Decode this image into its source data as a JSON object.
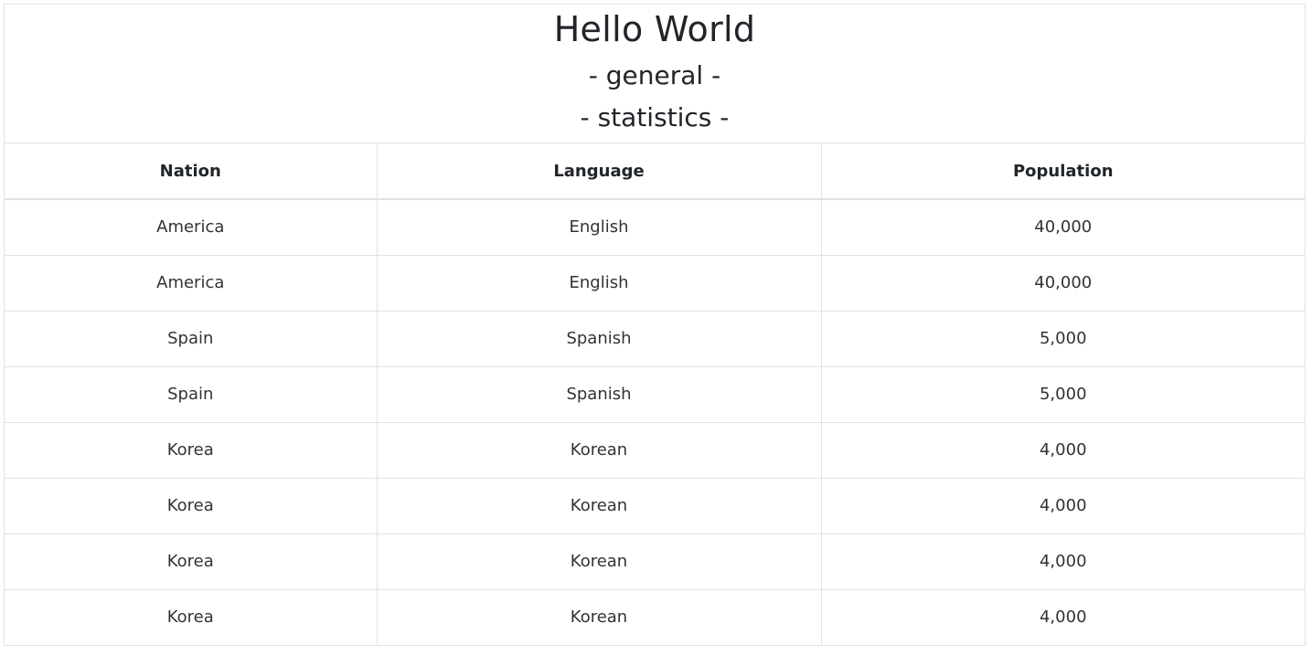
{
  "caption": {
    "title": "Hello World",
    "subtitle1": "- general -",
    "subtitle2": "- statistics -"
  },
  "table": {
    "headers": [
      "Nation",
      "Language",
      "Population"
    ],
    "rows": [
      [
        "America",
        "English",
        "40,000"
      ],
      [
        "America",
        "English",
        "40,000"
      ],
      [
        "Spain",
        "Spanish",
        "5,000"
      ],
      [
        "Spain",
        "Spanish",
        "5,000"
      ],
      [
        "Korea",
        "Korean",
        "4,000"
      ],
      [
        "Korea",
        "Korean",
        "4,000"
      ],
      [
        "Korea",
        "Korean",
        "4,000"
      ],
      [
        "Korea",
        "Korean",
        "4,000"
      ]
    ]
  }
}
